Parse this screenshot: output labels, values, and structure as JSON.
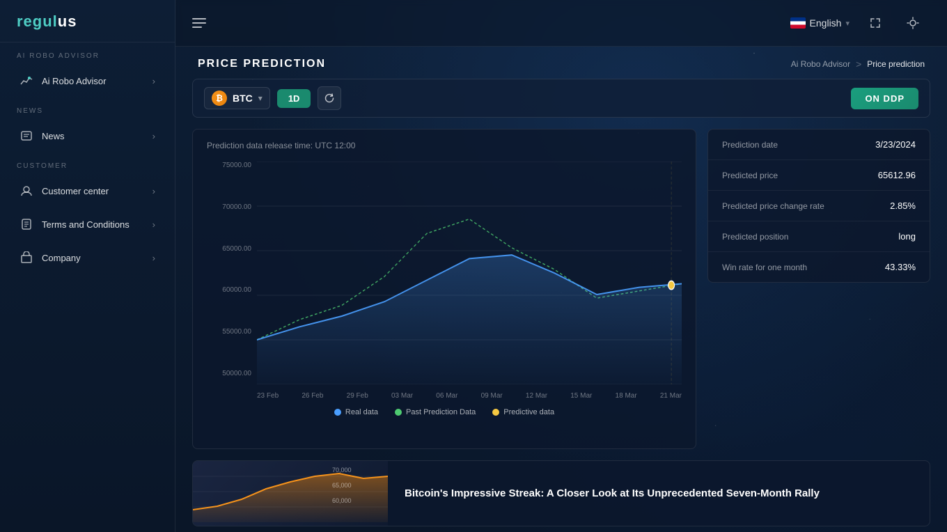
{
  "app": {
    "logo": "regulus",
    "name": "Ai RoBO Advisor"
  },
  "sidebar": {
    "sections": [
      {
        "label": "AI ROBO ADVISOR",
        "items": [
          {
            "id": "ai-robo-advisor",
            "label": "Ai Robo Advisor",
            "icon": "chart-icon",
            "arrow": true
          }
        ]
      },
      {
        "label": "NEWS",
        "items": [
          {
            "id": "news",
            "label": "News",
            "icon": "news-icon",
            "arrow": true
          }
        ]
      },
      {
        "label": "CUSTOMER",
        "items": [
          {
            "id": "customer-center",
            "label": "Customer center",
            "icon": "support-icon",
            "arrow": true
          },
          {
            "id": "terms-conditions",
            "label": "Terms and Conditions",
            "icon": "doc-icon",
            "arrow": true
          },
          {
            "id": "company",
            "label": "Company",
            "icon": "building-icon",
            "arrow": true
          }
        ]
      }
    ]
  },
  "header": {
    "language": "English",
    "lang_flag": "UK"
  },
  "breadcrumb": {
    "root": "Ai Robo Advisor",
    "separator": ">",
    "current": "Price prediction"
  },
  "page_title": "PRICE PREDICTION",
  "controls": {
    "coin": "BTC",
    "timeframe": "1D",
    "ddp_button": "ON DDP"
  },
  "chart": {
    "release_time": "Prediction data release time: UTC 12:00",
    "x_labels": [
      "23 Feb",
      "26 Feb",
      "29 Feb",
      "03 Mar",
      "06 Mar",
      "09 Mar",
      "12 Mar",
      "15 Mar",
      "18 Mar",
      "21 Mar"
    ],
    "y_labels": [
      "75000.00",
      "70000.00",
      "65000.00",
      "60000.00",
      "55000.00",
      "50000.00"
    ],
    "legend": [
      {
        "label": "Real data",
        "color": "#4a9eff"
      },
      {
        "label": "Past Prediction Data",
        "color": "#4ecb71"
      },
      {
        "label": "Predictive data",
        "color": "#f5c842"
      }
    ]
  },
  "info_panel": {
    "rows": [
      {
        "label": "Prediction date",
        "value": "3/23/2024"
      },
      {
        "label": "Predicted price",
        "value": "65612.96"
      },
      {
        "label": "Predicted price change rate",
        "value": "2.85%"
      },
      {
        "label": "Predicted position",
        "value": "long"
      },
      {
        "label": "Win rate for one month",
        "value": "43.33%"
      }
    ]
  },
  "news": {
    "title": "Bitcoin's Impressive Streak: A Closer Look at Its Unprecedented Seven-Month Rally"
  }
}
